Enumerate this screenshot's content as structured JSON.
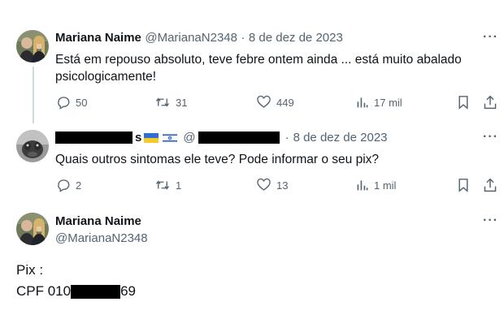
{
  "tweet1": {
    "author_name": "Mariana Naime",
    "handle": "@MarianaN2348",
    "separator": "·",
    "date": "8 de dez de 2023",
    "text_line1": "Está em repouso absoluto, teve febre ontem ainda ... está muito abalado",
    "text_line2": "psicologicamente!",
    "actions": {
      "replies": "50",
      "reposts": "31",
      "likes": "449",
      "views": "17 mil"
    },
    "more": "···"
  },
  "tweet2": {
    "author_name_suffix": "s",
    "flags": [
      "ukraine-flag-icon",
      "israel-flag-icon"
    ],
    "handle_prefix": "@",
    "separator": "·",
    "date": "8 de dez de 2023",
    "text": "Quais outros sintomas ele teve? Pode informar o seu pix?",
    "actions": {
      "replies": "2",
      "reposts": "1",
      "likes": "13",
      "views": "1 mil"
    },
    "more": "···"
  },
  "tweet3": {
    "author_name": "Mariana Naime",
    "handle": "@MarianaN2348",
    "text_line1": "Pix :",
    "cpf_prefix": "CPF 010",
    "cpf_suffix": "69",
    "more": "···"
  },
  "colors": {
    "text": "#0f1419",
    "muted": "#536471",
    "line": "#cfd9de",
    "redaction": "#000000"
  }
}
